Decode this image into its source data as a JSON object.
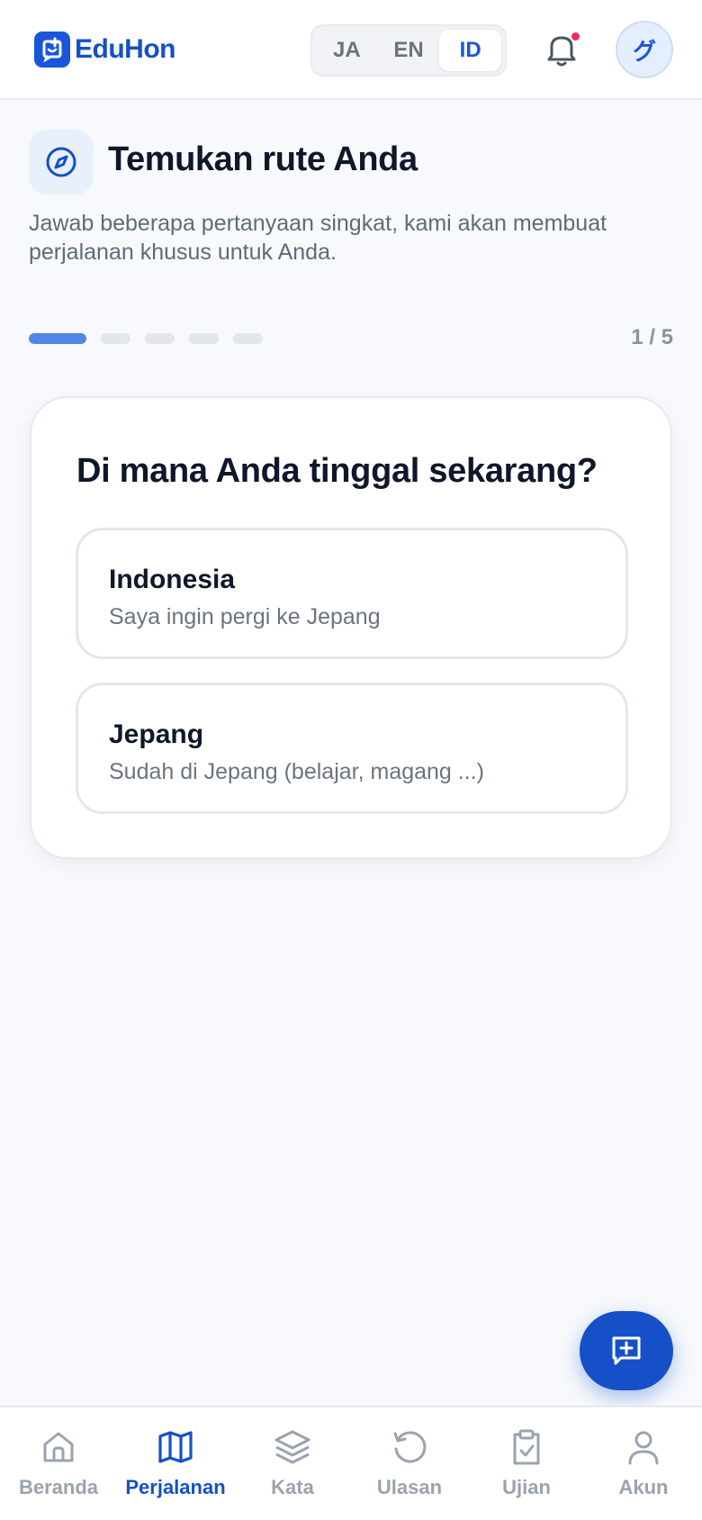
{
  "header": {
    "brand": "EduHon",
    "languages": [
      {
        "code": "JA",
        "active": false
      },
      {
        "code": "EN",
        "active": false
      },
      {
        "code": "ID",
        "active": true
      }
    ],
    "avatar_initial": "グ",
    "notification_dot": true
  },
  "intro": {
    "title": "Temukan rute Anda",
    "subtitle": "Jawab beberapa pertanyaan singkat, kami akan membuat perjalanan khusus untuk Anda."
  },
  "progress": {
    "current": 1,
    "total": 5,
    "label": "1 / 5"
  },
  "question": {
    "text": "Di mana Anda tinggal sekarang?",
    "options": [
      {
        "title": "Indonesia",
        "description": "Saya ingin pergi ke Jepang"
      },
      {
        "title": "Jepang",
        "description": "Sudah di Jepang (belajar, magang ...)"
      }
    ]
  },
  "nav": {
    "items": [
      {
        "label": "Beranda",
        "icon": "home-icon",
        "active": false
      },
      {
        "label": "Perjalanan",
        "icon": "map-icon",
        "active": true
      },
      {
        "label": "Kata",
        "icon": "layers-icon",
        "active": false
      },
      {
        "label": "Ulasan",
        "icon": "history-icon",
        "active": false
      },
      {
        "label": "Ujian",
        "icon": "clipboard-check-icon",
        "active": false
      },
      {
        "label": "Akun",
        "icon": "user-icon",
        "active": false
      }
    ]
  },
  "colors": {
    "brand": "#1550c8",
    "accent_progress": "#4f86e8",
    "notification": "#ef2b5c",
    "background": "#f7f9fc"
  }
}
